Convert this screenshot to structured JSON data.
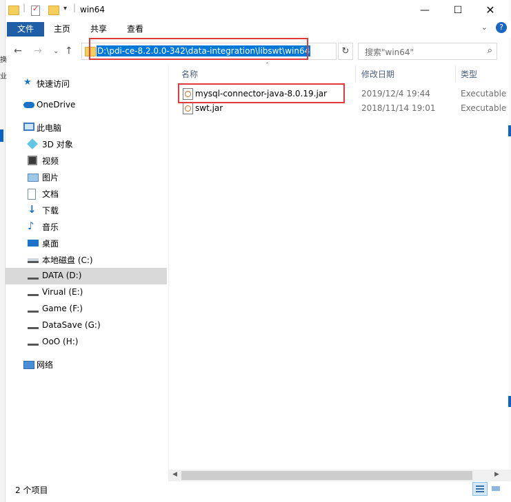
{
  "window": {
    "title": "win64"
  },
  "background_window": {
    "edge_chars": [
      "换",
      "业"
    ]
  },
  "ribbon": {
    "tabs": [
      {
        "label": "文件",
        "active": true
      },
      {
        "label": "主页"
      },
      {
        "label": "共享"
      },
      {
        "label": "查看"
      }
    ],
    "help_label": "?"
  },
  "address": {
    "path": "D:\\pdi-ce-8.2.0.0-342\\data-integration\\libswt\\win64"
  },
  "search": {
    "placeholder": "搜索\"win64\""
  },
  "nav": {
    "items": [
      {
        "label": "快速访问",
        "icon": "star-icon"
      },
      {
        "label": "OneDrive",
        "icon": "cloud-icon"
      },
      {
        "label": "此电脑",
        "icon": "computer-icon"
      },
      {
        "label": "3D 对象",
        "icon": "cube-icon"
      },
      {
        "label": "视频",
        "icon": "video-icon"
      },
      {
        "label": "图片",
        "icon": "picture-icon"
      },
      {
        "label": "文档",
        "icon": "document-icon"
      },
      {
        "label": "下载",
        "icon": "download-icon"
      },
      {
        "label": "音乐",
        "icon": "music-icon"
      },
      {
        "label": "桌面",
        "icon": "desktop-icon"
      },
      {
        "label": "本地磁盘 (C:)",
        "icon": "drive-c-icon"
      },
      {
        "label": "DATA (D:)",
        "icon": "drive-icon",
        "selected": true
      },
      {
        "label": "Virual (E:)",
        "icon": "drive-icon"
      },
      {
        "label": "Game (F:)",
        "icon": "drive-icon"
      },
      {
        "label": "DataSave (G:)",
        "icon": "drive-icon"
      },
      {
        "label": "OoO (H:)",
        "icon": "drive-icon"
      },
      {
        "label": "网络",
        "icon": "network-icon"
      }
    ]
  },
  "columns": {
    "name": "名称",
    "modified": "修改日期",
    "type": "类型"
  },
  "files": [
    {
      "name": "mysql-connector-java-8.0.19.jar",
      "modified": "2019/12/4 19:44",
      "type": "Executable",
      "highlighted": true
    },
    {
      "name": "swt.jar",
      "modified": "2018/11/14 19:01",
      "type": "Executable"
    }
  ],
  "status": {
    "item_count": "2 个项目"
  },
  "colors": {
    "accent": "#0078d7",
    "file_tab": "#1e5fa8",
    "highlight_box": "#e03a3a",
    "selected_nav": "#d9d9d9"
  }
}
